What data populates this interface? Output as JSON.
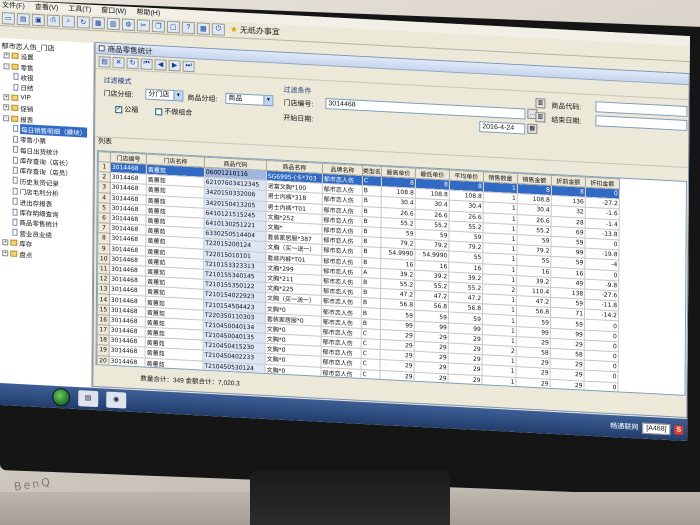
{
  "menu": [
    "文件(F)",
    "查看(V)",
    "工具(T)",
    "窗口(W)",
    "帮助(H)"
  ],
  "app_title": "无纸办事宜",
  "tree": {
    "root": "郁市恋人伤_门店",
    "nodes": [
      {
        "label": "设置",
        "level": 1,
        "kind": "folder",
        "sign": "+"
      },
      {
        "label": "零售",
        "level": 1,
        "kind": "folder",
        "sign": "-"
      },
      {
        "label": "收银",
        "level": 2,
        "kind": "doc"
      },
      {
        "label": "日结",
        "level": 2,
        "kind": "doc"
      },
      {
        "label": "VIP",
        "level": 1,
        "kind": "folder",
        "sign": "+"
      },
      {
        "label": "促销",
        "level": 1,
        "kind": "folder",
        "sign": "+"
      },
      {
        "label": "报表",
        "level": 1,
        "kind": "folder",
        "sign": "-"
      },
      {
        "label": "每日销售明细（模块）",
        "level": 2,
        "kind": "doc",
        "selected": true
      },
      {
        "label": "零售小票",
        "level": 2,
        "kind": "doc"
      },
      {
        "label": "每日出货统计",
        "level": 2,
        "kind": "doc"
      },
      {
        "label": "库存查询（店长）",
        "level": 2,
        "kind": "doc"
      },
      {
        "label": "库存查询（店员）",
        "level": 2,
        "kind": "doc"
      },
      {
        "label": "历史发货记录",
        "level": 2,
        "kind": "doc"
      },
      {
        "label": "门店毛利分析",
        "level": 2,
        "kind": "doc"
      },
      {
        "label": "进出存报表",
        "level": 2,
        "kind": "doc"
      },
      {
        "label": "库存明细查询",
        "level": 2,
        "kind": "doc"
      },
      {
        "label": "商品零售统计",
        "level": 2,
        "kind": "doc"
      },
      {
        "label": "营业员业绩",
        "level": 2,
        "kind": "doc"
      },
      {
        "label": "库存",
        "level": 1,
        "kind": "folder",
        "sign": "+"
      },
      {
        "label": "盘点",
        "level": 1,
        "kind": "folder",
        "sign": "+"
      }
    ]
  },
  "window": {
    "title": "商品零售统计",
    "filter_mode_title": "过滤模式",
    "store_group_label": "门店分组:",
    "store_group_value": "分门店",
    "product_group_label": "商品分组:",
    "product_group_value": "商品",
    "show_gift_label": "公福",
    "show_gift_checked": true,
    "no_combine_label": "不做组合",
    "no_combine_checked": false,
    "condition_title": "过滤条件",
    "store_code_label": "门店编号:",
    "store_code_value": "3014468",
    "start_date_label": "开始日期:",
    "start_date_value": "2016-4-24",
    "product_code_label": "商品代码:",
    "product_code_value": "",
    "end_date_label": "结束日期:",
    "end_date_value": "",
    "list_label": "列表"
  },
  "table": {
    "columns": [
      "门店编号",
      "门店名称",
      "商品代码",
      "商品名称",
      "品牌名称",
      "类型名",
      "最高单价",
      "最低单价",
      "平均单价",
      "销售数量",
      "销售金额",
      "折前金额",
      "折扣金额"
    ],
    "rows": [
      [
        "3014468",
        "黄蕙茹",
        "06001210116",
        "SG6995-(卡*703",
        "郁市恋人伤",
        "C",
        "8",
        "8",
        "8",
        "1",
        "8",
        "8",
        "0"
      ],
      [
        "3014468",
        "黄蕙茹",
        "62107603412345",
        "诺富文胸*100",
        "郁市恋人伤",
        "B",
        "108.8",
        "108.8",
        "108.8",
        "1",
        "108.8",
        "136",
        "-27.2"
      ],
      [
        "3014468",
        "黄蕙茹",
        "3420150332006",
        "男士内裤*318",
        "郁市恋人伤",
        "B",
        "30.4",
        "30.4",
        "30.4",
        "1",
        "30.4",
        "32",
        "-1.6"
      ],
      [
        "3014468",
        "黄蕙茹",
        "3420150413205",
        "男士内裤*T01",
        "郁市恋人伤",
        "B",
        "26.6",
        "26.6",
        "26.6",
        "1",
        "26.6",
        "28",
        "-1.4"
      ],
      [
        "3014468",
        "黄蕙茹",
        "6410121515245",
        "文胸*252",
        "郁市恋人伤",
        "B",
        "55.2",
        "55.2",
        "55.2",
        "1",
        "55.2",
        "69",
        "-13.8"
      ],
      [
        "3014468",
        "黄蕙茹",
        "6410130251221",
        "文胸*",
        "郁市恋人伤",
        "B",
        "59",
        "59",
        "59",
        "1",
        "59",
        "59",
        "0"
      ],
      [
        "3014468",
        "黄蕙茹",
        "6330250514404",
        "套装家居服*387",
        "郁市恋人伤",
        "B",
        "79.2",
        "79.2",
        "79.2",
        "1",
        "79.2",
        "99",
        "-19.8"
      ],
      [
        "3014468",
        "黄蕙茹",
        "T22015200124",
        "文胸（买一送一）",
        "郁市恋人伤",
        "B",
        "54.9990",
        "54.9990",
        "55",
        "1",
        "55",
        "59",
        "-4"
      ],
      [
        "3014468",
        "黄蕙茹",
        "T22015010101",
        "套装内裤*T01",
        "郁市恋人伤",
        "B",
        "16",
        "16",
        "16",
        "1",
        "16",
        "16",
        "0"
      ],
      [
        "3014468",
        "黄蕙茹",
        "T210153323313",
        "文胸*299",
        "郁市恋人伤",
        "A",
        "39.2",
        "39.2",
        "39.2",
        "1",
        "39.2",
        "49",
        "-9.8"
      ],
      [
        "3014468",
        "黄蕙茹",
        "T210155340145",
        "文胸*211",
        "郁市恋人伤",
        "B",
        "55.2",
        "55.2",
        "55.2",
        "2",
        "110.4",
        "138",
        "-27.6"
      ],
      [
        "3014468",
        "黄蕙茹",
        "T210155350122",
        "文胸*225",
        "郁市恋人伤",
        "B",
        "47.2",
        "47.2",
        "47.2",
        "1",
        "47.2",
        "59",
        "-11.8"
      ],
      [
        "3014468",
        "黄蕙茹",
        "T210154022923",
        "文胸（买一送一）",
        "郁市恋人伤",
        "B",
        "56.8",
        "56.8",
        "56.8",
        "1",
        "56.8",
        "71",
        "-14.2"
      ],
      [
        "3014468",
        "黄蕙茹",
        "T210154504423",
        "文胸*0",
        "郁市恋人伤",
        "B",
        "59",
        "59",
        "59",
        "1",
        "59",
        "59",
        "0"
      ],
      [
        "3014468",
        "黄蕙茹",
        "T220350110303",
        "套装家居服*0",
        "郁市恋人伤",
        "B",
        "99",
        "99",
        "99",
        "1",
        "99",
        "99",
        "0"
      ],
      [
        "3014468",
        "黄蕙茹",
        "T210450040134",
        "文胸*0",
        "郁市恋人伤",
        "C",
        "29",
        "29",
        "29",
        "1",
        "29",
        "29",
        "0"
      ],
      [
        "3014468",
        "黄蕙茹",
        "T210450040135",
        "文胸*0",
        "郁市恋人伤",
        "C",
        "29",
        "29",
        "29",
        "2",
        "58",
        "58",
        "0"
      ],
      [
        "3014468",
        "黄蕙茹",
        "T210450415230",
        "文胸*0",
        "郁市恋人伤",
        "C",
        "29",
        "29",
        "29",
        "1",
        "29",
        "29",
        "0"
      ],
      [
        "3014468",
        "黄蕙茹",
        "T210450402233",
        "文胸*0",
        "郁市恋人伤",
        "C",
        "29",
        "29",
        "29",
        "1",
        "29",
        "29",
        "0"
      ],
      [
        "3014468",
        "黄蕙茹",
        "T210450530124",
        "文胸*0",
        "郁市恋人伤",
        "C",
        "29",
        "29",
        "29",
        "1",
        "29",
        "29",
        "0"
      ]
    ],
    "selected_row": 0
  },
  "summary": "数量合计：349 金额合计：7,020.3",
  "taskbar": {
    "task_label": "畅通",
    "tray_text": "畅通联网",
    "ime_label": "[A468]",
    "ime_brand": "S"
  }
}
